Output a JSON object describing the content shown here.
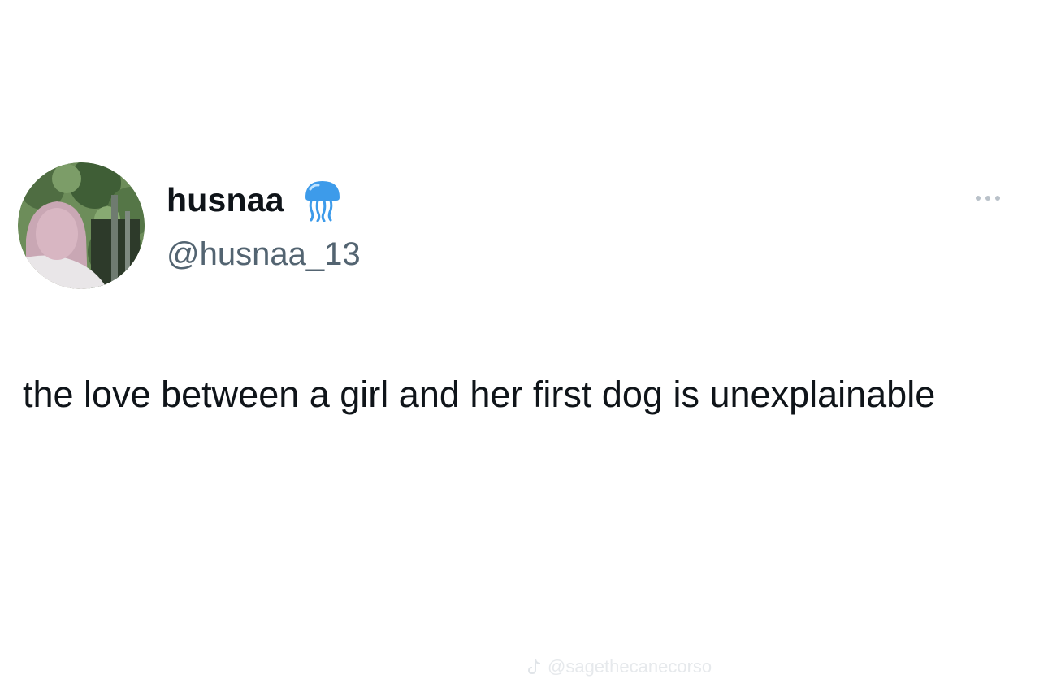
{
  "tweet": {
    "display_name": "husnaa",
    "handle": "@husnaa_13",
    "badge_icon": "jellyfish-icon",
    "text": "the love between a girl and her first dog is unexplainable",
    "more_icon": "more-horizontal-icon"
  },
  "watermark": {
    "icon": "tiktok-icon",
    "text": "@sagethecanecorso"
  },
  "colors": {
    "background": "#ffffff",
    "text_primary": "#0f1419",
    "text_secondary": "#536471",
    "badge": "#3d9bea"
  }
}
